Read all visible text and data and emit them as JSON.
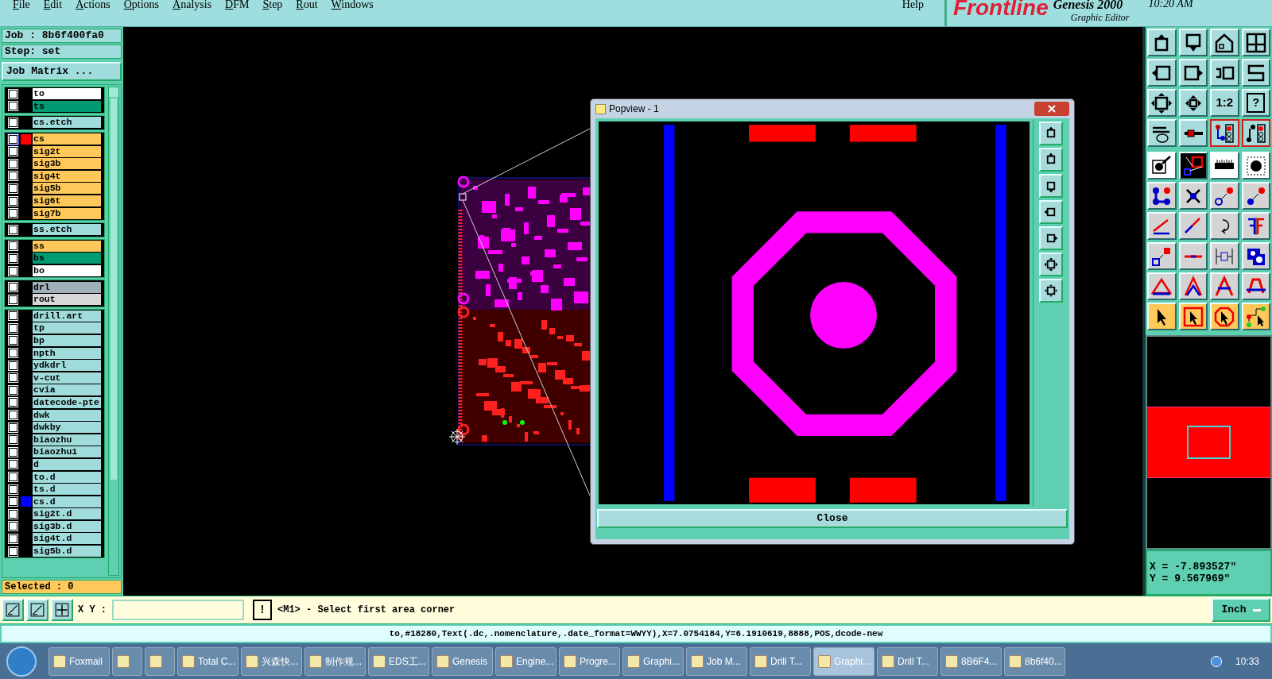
{
  "menu_bar": {
    "items": [
      "File",
      "Edit",
      "Actions",
      "Options",
      "Analysis",
      "DFM",
      "Step",
      "Rout",
      "Windows"
    ],
    "help": "Help"
  },
  "brand": {
    "logo": "Frontline",
    "product": "Genesis 2000",
    "subtitle": "Graphic Editor",
    "time": "10:20 AM"
  },
  "left_panel": {
    "job": "Job : 8b6f400fa0",
    "step": "Step: set",
    "matrix_button": "Job Matrix ...",
    "layer_groups": [
      [
        {
          "name": "to",
          "color": "#ffffff",
          "selected": false
        },
        {
          "name": "ts",
          "color": "#009a73",
          "selected": false
        }
      ],
      [
        {
          "name": "cs.etch",
          "color": "#a0dcdc",
          "selected": false
        }
      ],
      [
        {
          "name": "cs",
          "color": "#ffc85a",
          "swatch": {
            "color": "#ff0000"
          },
          "selected": true
        },
        {
          "name": "sig2t",
          "color": "#ffc85a",
          "selected": false
        },
        {
          "name": "sig3b",
          "color": "#ffc85a",
          "selected": false
        },
        {
          "name": "sig4t",
          "color": "#ffc85a",
          "selected": false
        },
        {
          "name": "sig5b",
          "color": "#ffc85a",
          "selected": false
        },
        {
          "name": "sig6t",
          "color": "#ffc85a",
          "selected": false
        },
        {
          "name": "sig7b",
          "color": "#ffc85a",
          "selected": false
        }
      ],
      [
        {
          "name": "ss.etch",
          "color": "#a0dcdc",
          "selected": false
        }
      ],
      [
        {
          "name": "ss",
          "color": "#ffc85a",
          "selected": false
        },
        {
          "name": "bs",
          "color": "#009a73",
          "selected": false
        },
        {
          "name": "bo",
          "color": "#ffffff",
          "selected": false
        }
      ],
      [
        {
          "name": "drl",
          "color": "#9fb0b8",
          "selected": false
        },
        {
          "name": "rout",
          "color": "#d8d8d8",
          "selected": false
        }
      ],
      [
        {
          "name": "drill.art",
          "color": "#a0dcdc",
          "selected": false
        },
        {
          "name": "tp",
          "color": "#a0dcdc",
          "selected": false
        },
        {
          "name": "bp",
          "color": "#a0dcdc",
          "selected": false
        },
        {
          "name": "npth",
          "color": "#a0dcdc",
          "selected": false
        },
        {
          "name": "ydkdrl",
          "color": "#a0dcdc",
          "selected": false
        },
        {
          "name": "v-cut",
          "color": "#a0dcdc",
          "selected": false
        },
        {
          "name": "cvia",
          "color": "#a0dcdc",
          "selected": false
        },
        {
          "name": "datecode-pte",
          "color": "#a0dcdc",
          "selected": false
        },
        {
          "name": "dwk",
          "color": "#a0dcdc",
          "selected": false
        },
        {
          "name": "dwkby",
          "color": "#a0dcdc",
          "selected": false
        },
        {
          "name": "biaozhu",
          "color": "#a0dcdc",
          "selected": false
        },
        {
          "name": "biaozhu1",
          "color": "#a0dcdc",
          "selected": false
        },
        {
          "name": "d",
          "color": "#a0dcdc",
          "selected": false
        },
        {
          "name": "to.d",
          "color": "#a0dcdc",
          "selected": false
        },
        {
          "name": "ts.d",
          "color": "#a0dcdc",
          "selected": false
        },
        {
          "name": "cs.d",
          "color": "#a0dcdc",
          "swatch": {
            "color": "#0000ff"
          },
          "selected": false
        },
        {
          "name": "sig2t.d",
          "color": "#a0dcdc",
          "selected": false
        },
        {
          "name": "sig3b.d",
          "color": "#a0dcdc",
          "selected": false
        },
        {
          "name": "sig4t.d",
          "color": "#a0dcdc",
          "selected": false
        },
        {
          "name": "sig5b.d",
          "color": "#a0dcdc",
          "selected": false
        }
      ]
    ],
    "selected_count": "Selected : 0"
  },
  "right_toolbar": {
    "ratio_button": "1:2",
    "help_button": "?"
  },
  "popview": {
    "title": "Popview - 1",
    "close_button": "Close"
  },
  "coordinates": {
    "x": "X = -7.893527\"",
    "y": "Y = 9.567969\""
  },
  "command_bar": {
    "label": "X Y :",
    "prompt_button": "!",
    "message": "<M1> - Select first area corner",
    "units": "Inch"
  },
  "status_line": "to,#18280,Text(.dc,.nomenclature,.date_format=WWYY),X=7.0754184,Y=6.1910619,8888,POS,dcode-new",
  "taskbar": {
    "items": [
      {
        "label": "Foxmail",
        "selected": false
      },
      {
        "selected": false
      },
      {
        "selected": false
      },
      {
        "label": "Total C...",
        "selected": false
      },
      {
        "label": "兴森快...",
        "selected": false
      },
      {
        "label": "制作规...",
        "selected": false
      },
      {
        "label": "EDS工...",
        "selected": false
      },
      {
        "label": "Genesis",
        "selected": false
      },
      {
        "label": "Engine...",
        "selected": false
      },
      {
        "label": "Progre...",
        "selected": false
      },
      {
        "label": "Graphi...",
        "selected": false
      },
      {
        "label": "Job M...",
        "selected": false
      },
      {
        "label": "Drill T...",
        "selected": false
      },
      {
        "label": "Graphi...",
        "selected": true
      },
      {
        "label": "Drill T...",
        "selected": false
      },
      {
        "label": "8B6F4...",
        "selected": false
      },
      {
        "label": "8b6f40...",
        "selected": false
      }
    ],
    "clock": "10:33"
  }
}
